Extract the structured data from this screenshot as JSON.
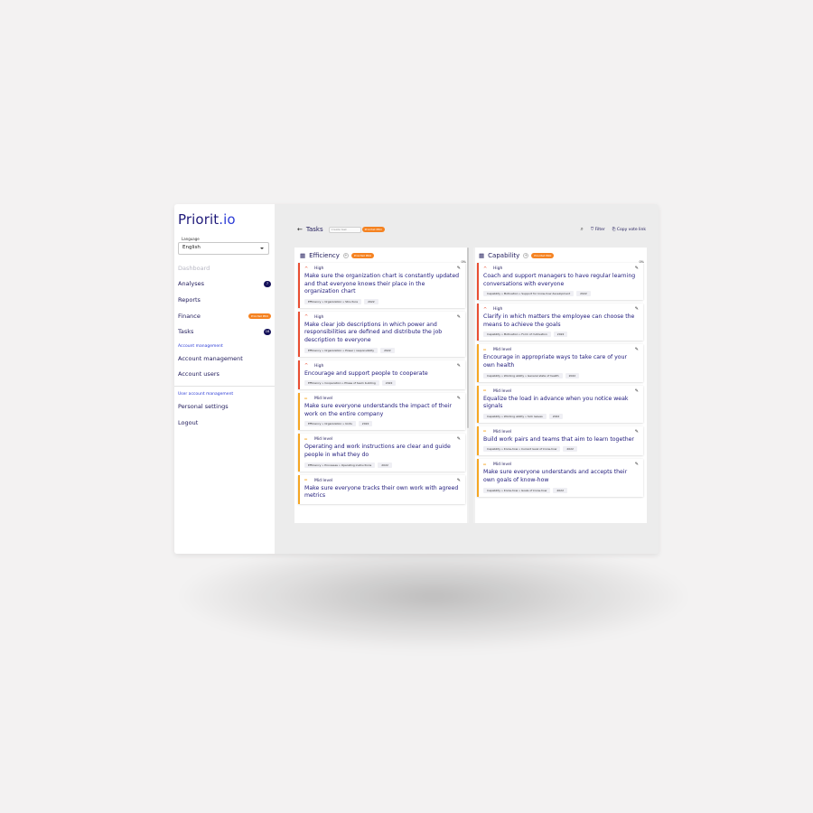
{
  "app": {
    "logo_text": "Priorit",
    "logo_dot": ".io"
  },
  "language": {
    "label": "Language",
    "value": "English"
  },
  "nav": {
    "dashboard": "Dashboard",
    "analyses": "Analyses",
    "analyses_count": "7",
    "reports": "Reports",
    "finance": "Finance",
    "finance_badge": "Prioritet PRO",
    "tasks": "Tasks",
    "tasks_count": "16",
    "section_account": "Account management",
    "account_management": "Account management",
    "account_users": "Account users",
    "section_user": "User account management",
    "personal_settings": "Personal settings",
    "logout": "Logout"
  },
  "topbar": {
    "back": "←",
    "title": "Tasks",
    "create_placeholder": "Create task",
    "create_badge": "Prioritet PRO",
    "filter": "Filter",
    "copy_vote_link": "Copy vote link"
  },
  "columns": [
    {
      "name": "Efficiency",
      "badge": "Prioritet PRO",
      "percent": "0%",
      "cards": [
        {
          "priority": "High",
          "title": "Make sure the organization chart is constantly updated and that everyone knows their place in the organization chart",
          "tag": "Efficiency » Organization » Structure",
          "year": "2022"
        },
        {
          "priority": "High",
          "title": "Make clear job descriptions in which power and responsibilities are defined and distribute the job description to everyone",
          "tag": "Efficiency » Organization » Power / responsibility",
          "year": "2022"
        },
        {
          "priority": "High",
          "title": "Encourage and support people to cooperate",
          "tag": "Efficiency » Cooperation » Phase of team building",
          "year": "2022"
        },
        {
          "priority": "Mid level",
          "title": "Make sure everyone understands the impact of their work on the entire company",
          "tag": "Efficiency » Organization » Units",
          "year": "2022"
        },
        {
          "priority": "Mid level",
          "title": "Operating and work instructions are clear and guide people in what they do",
          "tag": "Efficiency » Processes » Operating instructions",
          "year": "2022"
        },
        {
          "priority": "Mid level",
          "title": "Make sure everyone tracks their own work with agreed metrics",
          "tag": "",
          "year": ""
        }
      ]
    },
    {
      "name": "Capability",
      "badge": "Prioritet PRO",
      "percent": "0%",
      "cards": [
        {
          "priority": "High",
          "title": "Coach and support managers to have regular learning conversations with everyone",
          "tag": "Capability » Motivation » Support for know-how development",
          "year": "2022"
        },
        {
          "priority": "High",
          "title": "Clarify in which matters the employee can choose the means to achieve the goals",
          "tag": "Capability » Motivation » Form of motivation",
          "year": "2022"
        },
        {
          "priority": "Mid level",
          "title": "Encourage in appropriate ways to take care of your own health",
          "tag": "Capability » Working ability » General state of health",
          "year": "2022"
        },
        {
          "priority": "Mid level",
          "title": "Equalize the load in advance when you notice weak signals",
          "tag": "Capability » Working ability » Sick leaves",
          "year": "2022"
        },
        {
          "priority": "Mid level",
          "title": "Build work pairs and teams that aim to learn together",
          "tag": "Capability » Know-how » Current level of know-how",
          "year": "2022"
        },
        {
          "priority": "Mid level",
          "title": "Make sure everyone understands and accepts their own goals of know-how",
          "tag": "Capability » Know-how » Goals of know-how",
          "year": "2022"
        }
      ]
    }
  ],
  "colors": {
    "brand": "#1f1a7a",
    "high": "#e94e32",
    "mid": "#f5a623",
    "badge": "#f58220"
  }
}
